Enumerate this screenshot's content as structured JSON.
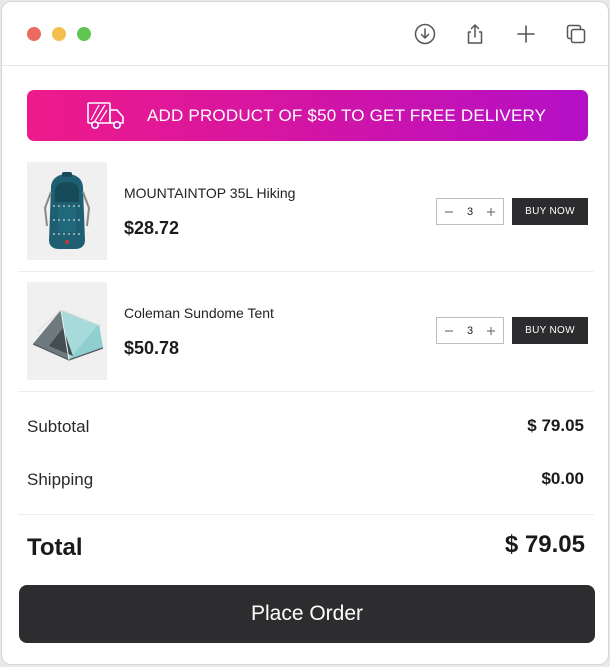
{
  "window": {
    "controls": [
      "close",
      "minimize",
      "zoom"
    ],
    "toolbar_icons": [
      "download-circle-icon",
      "share-icon",
      "plus-icon",
      "copy-icon"
    ]
  },
  "banner": {
    "icon": "truck-icon",
    "text": "ADD PRODUCT OF $50 TO GET FREE DELIVERY",
    "gradient": [
      "#ee1a8a",
      "#b40fc7"
    ]
  },
  "cart": {
    "items": [
      {
        "name": "MOUNTAINTOP 35L Hiking",
        "price": "$28.72",
        "quantity": "3",
        "image": "backpack",
        "buy_label": "BUY NOW"
      },
      {
        "name": "Coleman Sundome Tent",
        "price": "$50.78",
        "quantity": "3",
        "image": "tent",
        "buy_label": "BUY NOW"
      }
    ]
  },
  "summary": {
    "subtotal_label": "Subtotal",
    "subtotal_value": "$ 79.05",
    "shipping_label": "Shipping",
    "shipping_value": "$0.00",
    "total_label": "Total",
    "total_value": "$ 79.05"
  },
  "actions": {
    "place_order": "Place Order"
  },
  "colors": {
    "accent_dark": "#2d2d2f",
    "close": "#ec6a5f",
    "minimize": "#f4bf4f",
    "zoom": "#61c554"
  }
}
